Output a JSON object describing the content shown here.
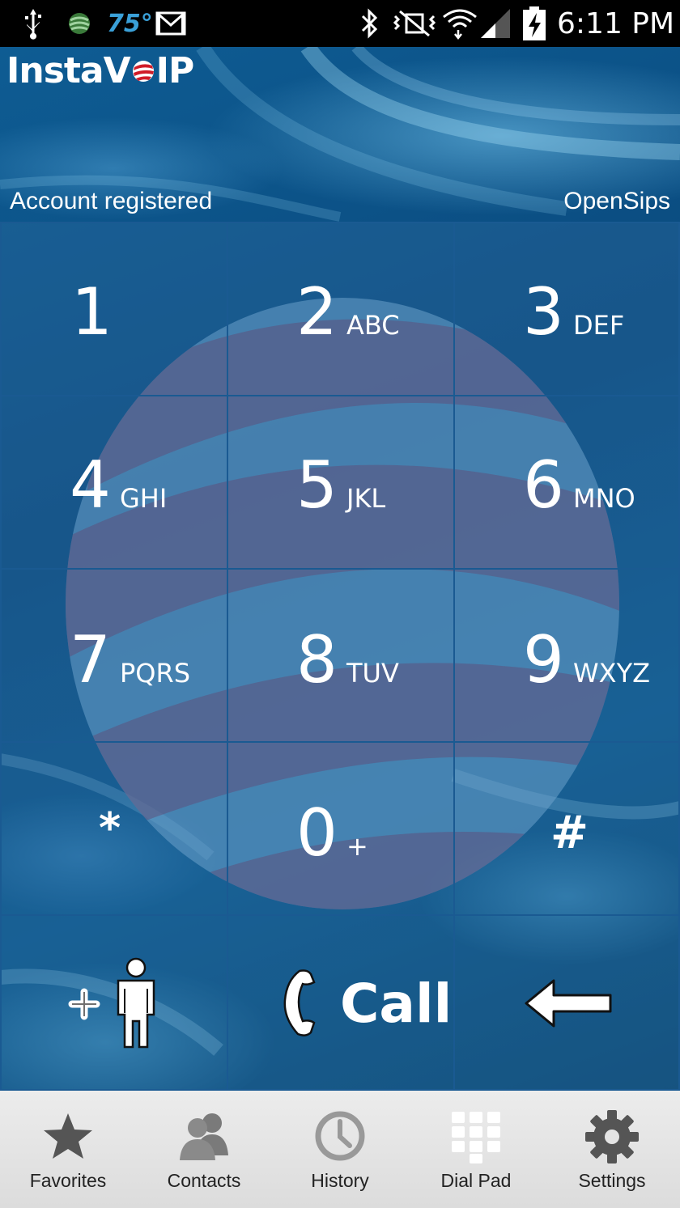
{
  "status_bar": {
    "temperature": "75°",
    "time": "6:11 PM"
  },
  "app": {
    "logo_text_left": "Insta",
    "logo_text_mid": "V",
    "logo_text_right": "IP"
  },
  "account": {
    "status": "Account registered",
    "provider": "OpenSips"
  },
  "keys": [
    {
      "num": "1",
      "letters": ""
    },
    {
      "num": "2",
      "letters": "ABC"
    },
    {
      "num": "3",
      "letters": "DEF"
    },
    {
      "num": "4",
      "letters": "GHI"
    },
    {
      "num": "5",
      "letters": "JKL"
    },
    {
      "num": "6",
      "letters": "MNO"
    },
    {
      "num": "7",
      "letters": "PQRS"
    },
    {
      "num": "8",
      "letters": "TUV"
    },
    {
      "num": "9",
      "letters": "WXYZ"
    },
    {
      "num": "*",
      "letters": ""
    },
    {
      "num": "0",
      "letters": "+"
    },
    {
      "num": "#",
      "letters": ""
    }
  ],
  "actions": {
    "call_label": "Call"
  },
  "tabs": [
    {
      "label": "Favorites",
      "icon": "star-icon"
    },
    {
      "label": "Contacts",
      "icon": "contacts-icon"
    },
    {
      "label": "History",
      "icon": "clock-icon"
    },
    {
      "label": "Dial Pad",
      "icon": "dialpad-icon"
    },
    {
      "label": "Settings",
      "icon": "gear-icon"
    }
  ]
}
